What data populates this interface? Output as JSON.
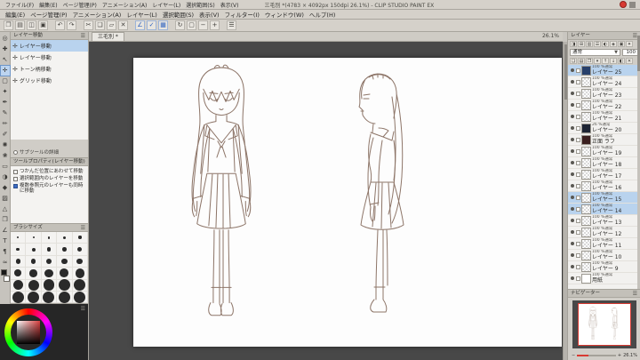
{
  "colors": {
    "selection_blue": "#b9d3ee",
    "accent_blue": "#2f62c0",
    "canvas_background": "#484848",
    "drawing_line": "#8d7568",
    "clip_studio_red": "#d83a32",
    "navigator_frame_red": "#d83a32"
  },
  "title_bar": {
    "menus": [
      "ファイル(F)",
      "編集(E)",
      "ページ管理(P)",
      "アニメーション(A)",
      "レイヤー(L)",
      "選択範囲(S)",
      "表示(V)"
    ],
    "title": "三毛別 *(4783 × 4092px 150dpi 26.1%) - CLIP STUDIO PAINT EX"
  },
  "menu_bar": [
    "編集(E)",
    "ページ管理(P)",
    "アニメーション(A)",
    "レイヤー(L)",
    "選択範囲(S)",
    "表示(V)",
    "フィルター(I)",
    "ウィンドウ(W)",
    "ヘルプ(H)"
  ],
  "command_bar": [
    {
      "name": "new-file-icon",
      "glyph": "❐"
    },
    {
      "name": "open-file-icon",
      "glyph": "▤"
    },
    {
      "name": "save-icon",
      "glyph": "◫"
    },
    {
      "name": "print-icon",
      "glyph": "▣"
    },
    {
      "name": "separator",
      "glyph": "",
      "sep": true
    },
    {
      "name": "undo-icon",
      "glyph": "↶"
    },
    {
      "name": "redo-icon",
      "glyph": "↷"
    },
    {
      "name": "separator",
      "glyph": "",
      "sep": true
    },
    {
      "name": "cut-icon",
      "glyph": "✂"
    },
    {
      "name": "copy-icon",
      "glyph": "❏"
    },
    {
      "name": "paste-icon",
      "glyph": "▱"
    },
    {
      "name": "delete-icon",
      "glyph": "✕"
    },
    {
      "name": "separator",
      "glyph": "",
      "sep": true
    },
    {
      "name": "snap-ruler-icon",
      "glyph": "∠",
      "blue": true
    },
    {
      "name": "snap-special-ruler-icon",
      "glyph": "✓",
      "blue": true
    },
    {
      "name": "snap-grid-icon",
      "glyph": "▦",
      "blue": true
    },
    {
      "name": "separator",
      "glyph": "",
      "sep": true
    },
    {
      "name": "rotate-view-icon",
      "glyph": "↻"
    },
    {
      "name": "fit-view-icon",
      "glyph": "▢"
    },
    {
      "name": "zoom-out-icon",
      "glyph": "−"
    },
    {
      "name": "zoom-in-icon",
      "glyph": "+"
    },
    {
      "name": "separator",
      "glyph": "",
      "sep": true
    },
    {
      "name": "workspace-menu-icon",
      "glyph": "☰"
    }
  ],
  "canvas_tab": {
    "label": "三毛別 *",
    "zoom": "26.1%"
  },
  "tool_strip": [
    {
      "name": "zoom-tool",
      "glyph": "◎"
    },
    {
      "name": "move-view-tool",
      "glyph": "✚"
    },
    {
      "name": "operation-tool",
      "glyph": "↖"
    },
    {
      "name": "layer-move-tool",
      "glyph": "✛",
      "selected": true
    },
    {
      "name": "selection-tool",
      "glyph": "▢"
    },
    {
      "name": "auto-select-tool",
      "glyph": "✦"
    },
    {
      "name": "eyedropper-tool",
      "glyph": "✒"
    },
    {
      "name": "pen-tool",
      "glyph": "✎"
    },
    {
      "name": "pencil-tool",
      "glyph": "✏"
    },
    {
      "name": "brush-tool",
      "glyph": "✐"
    },
    {
      "name": "airbrush-tool",
      "glyph": "✺"
    },
    {
      "name": "decoration-tool",
      "glyph": "❀"
    },
    {
      "name": "eraser-tool",
      "glyph": "▭"
    },
    {
      "name": "blend-tool",
      "glyph": "◑"
    },
    {
      "name": "fill-tool",
      "glyph": "◆"
    },
    {
      "name": "gradient-tool",
      "glyph": "▨"
    },
    {
      "name": "figure-tool",
      "glyph": "△"
    },
    {
      "name": "frame-border-tool",
      "glyph": "❒"
    },
    {
      "name": "ruler-tool",
      "glyph": "∠"
    },
    {
      "name": "text-tool",
      "glyph": "T"
    },
    {
      "name": "story-tool",
      "glyph": "¶"
    },
    {
      "name": "line-correction-tool",
      "glyph": "≈"
    }
  ],
  "subtool_panel": {
    "title": "レイヤー移動",
    "items": [
      {
        "label": "レイヤー移動",
        "selected": true
      },
      {
        "label": "レイヤー移動",
        "selected": false
      },
      {
        "label": "トーン柄移動",
        "selected": false
      },
      {
        "label": "グリッド移動",
        "selected": false
      }
    ],
    "footer": "サブツールの詳細"
  },
  "tool_property": {
    "title": "ツールプロパティ(レイヤー移動)",
    "options": [
      {
        "label": "つかんだ位置にあわせて移動",
        "checked": false
      },
      {
        "label": "選択範囲内のレイヤーを移動",
        "checked": false
      },
      {
        "label": "複数参照元のレイヤーも同時に移動",
        "checked": true
      }
    ]
  },
  "brush_panel": {
    "title": "ブラシサイズ",
    "sizes": [
      1,
      2,
      3,
      4,
      5,
      6,
      7,
      8,
      9,
      10,
      12,
      14,
      16,
      18,
      20,
      25,
      30,
      35,
      40,
      45,
      50,
      60,
      70,
      80,
      90,
      100,
      150,
      200,
      250,
      300
    ]
  },
  "layer_panel": {
    "title": "レイヤー",
    "icons_row": [
      {
        "name": "layer-color-icon",
        "glyph": "◨"
      },
      {
        "name": "combine-mode-icon",
        "glyph": "⊞"
      },
      {
        "name": "tone-icon",
        "glyph": "▥"
      },
      {
        "name": "layer-menu-icon",
        "glyph": "☰"
      },
      {
        "name": "opacity-icon",
        "glyph": "◐"
      },
      {
        "name": "lock-layer-icon",
        "glyph": "◈"
      },
      {
        "name": "lock-pixels-icon",
        "glyph": "▣"
      },
      {
        "name": "reference-layer-icon",
        "glyph": "✦"
      }
    ],
    "blend_mode": "通常",
    "opacity": "100",
    "icons_row2": [
      {
        "name": "new-layer-icon",
        "glyph": "❏"
      },
      {
        "name": "new-folder-icon",
        "glyph": "▤"
      },
      {
        "name": "duplicate-layer-icon",
        "glyph": "❐"
      },
      {
        "name": "merge-down-icon",
        "glyph": "▾"
      },
      {
        "name": "move-layer-up-icon",
        "glyph": "↑"
      },
      {
        "name": "move-layer-down-icon",
        "glyph": "↓"
      },
      {
        "name": "layer-mask-icon",
        "glyph": "◧"
      },
      {
        "name": "delete-layer-icon",
        "glyph": "✕"
      }
    ],
    "rows": [
      {
        "meta": "100 %通常",
        "name": "レイヤー 25",
        "selected": true,
        "thumb": "blue"
      },
      {
        "meta": "100 %通常",
        "name": "レイヤー 24",
        "thumb": "checker"
      },
      {
        "meta": "100 %通常",
        "name": "レイヤー 23",
        "thumb": "checker"
      },
      {
        "meta": "100 %通常",
        "name": "レイヤー 22",
        "thumb": "checker"
      },
      {
        "meta": "100 %通常",
        "name": "レイヤー 21",
        "thumb": "checker"
      },
      {
        "meta": "26 %通常",
        "name": "レイヤー 20",
        "thumb": "dark"
      },
      {
        "meta": "100 %通常",
        "name": "正面 ラフ",
        "thumb": "darkred"
      },
      {
        "meta": "100 %通常",
        "name": "レイヤー 19",
        "thumb": "checker"
      },
      {
        "meta": "100 %通常",
        "name": "レイヤー 18",
        "thumb": "checker"
      },
      {
        "meta": "100 %通常",
        "name": "レイヤー 17",
        "thumb": "checker"
      },
      {
        "meta": "100 %通常",
        "name": "レイヤー 16",
        "thumb": "checker"
      },
      {
        "meta": "100 %通常",
        "name": "レイヤー 15",
        "selected": true,
        "thumb": "checker"
      },
      {
        "meta": "100 %通常",
        "name": "レイヤー 14",
        "selected": true,
        "thumb": "checker"
      },
      {
        "meta": "100 %通常",
        "name": "レイヤー 13",
        "thumb": "checker"
      },
      {
        "meta": "100 %通常",
        "name": "レイヤー 12",
        "thumb": "checker"
      },
      {
        "meta": "100 %通常",
        "name": "レイヤー 11",
        "thumb": "checker"
      },
      {
        "meta": "100 %通常",
        "name": "レイヤー 10",
        "thumb": "checker"
      },
      {
        "meta": "100 %通常",
        "name": "レイヤー 9",
        "thumb": "checker"
      },
      {
        "meta": "100 %通常",
        "name": "用紙",
        "thumb": "white"
      }
    ]
  },
  "navigator": {
    "title": "ナビゲーター",
    "zoom": "26.1%",
    "zoom_out_label": "−",
    "zoom_in_label": "+"
  }
}
